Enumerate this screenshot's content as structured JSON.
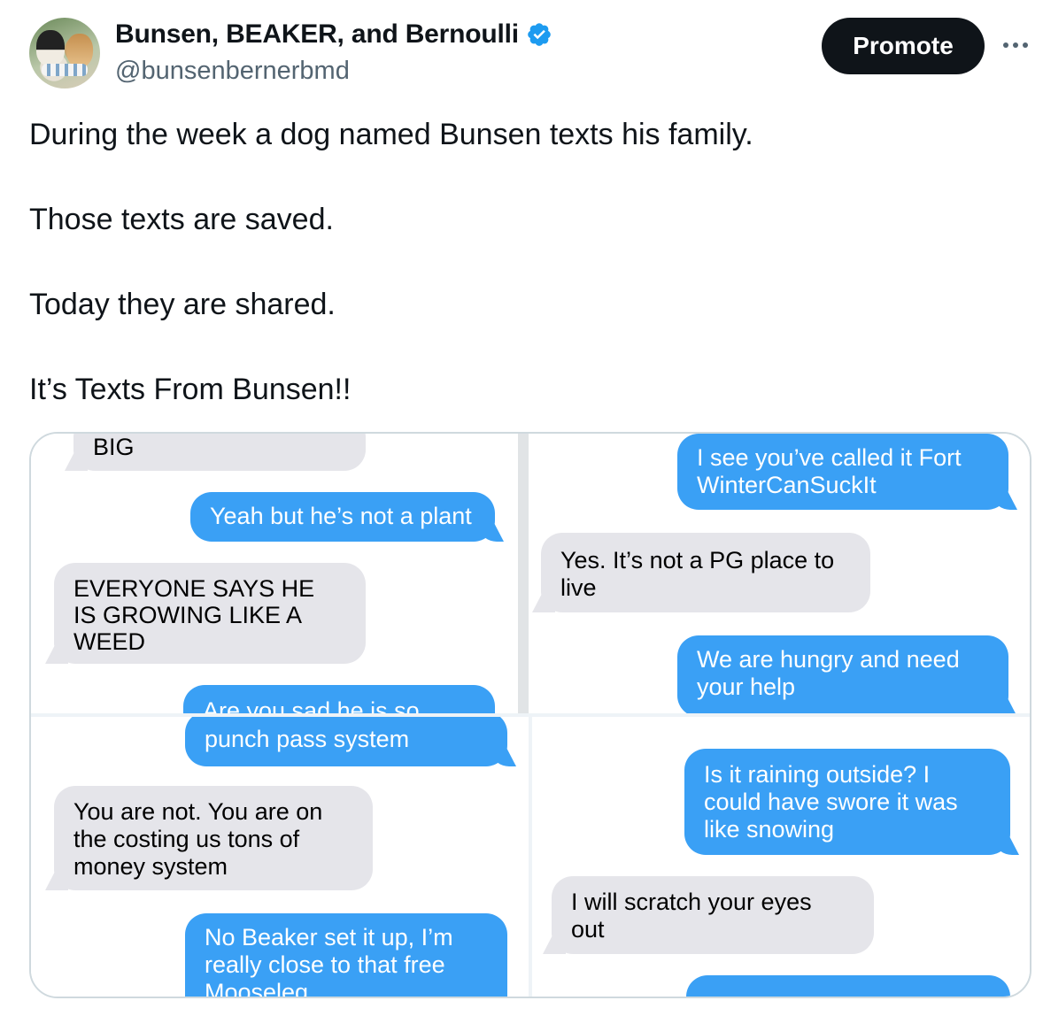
{
  "author": {
    "display_name": "Bunsen, BEAKER, and Bernoulli",
    "handle": "@bunsenbernerbmd"
  },
  "actions": {
    "promote_label": "Promote"
  },
  "tweet": {
    "paragraphs": [
      "During the week a dog named Bunsen texts his family.",
      "Those texts are saved.",
      "Today they are shared.",
      "It’s Texts From Bunsen!!"
    ]
  },
  "media": {
    "panel_1": {
      "msg_1": "BIG",
      "msg_2": "Yeah but he’s not a plant",
      "msg_3": "EVERYONE SAYS HE IS GROWING LIKE A WEED",
      "msg_4": "Are you sad he is so"
    },
    "panel_2": {
      "msg_1": "I see you’ve called it Fort WinterCanSuckIt",
      "msg_2": "Yes. It’s not a PG place to live",
      "msg_3": "We are hungry and need your help"
    },
    "panel_3": {
      "msg_1": "punch pass system",
      "msg_2": "You are not. You are on the costing us tons of money system",
      "msg_3": "No Beaker set it up, I’m really close to that free Mooseleg"
    },
    "panel_4": {
      "msg_1": "Is it raining outside? I could have swore it was like snowing",
      "msg_2": "I will scratch your eyes out"
    }
  },
  "colors": {
    "imessage_blue": "#3aa0f5",
    "imessage_gray": "#e5e5ea",
    "verified": "#1d9bf0"
  }
}
